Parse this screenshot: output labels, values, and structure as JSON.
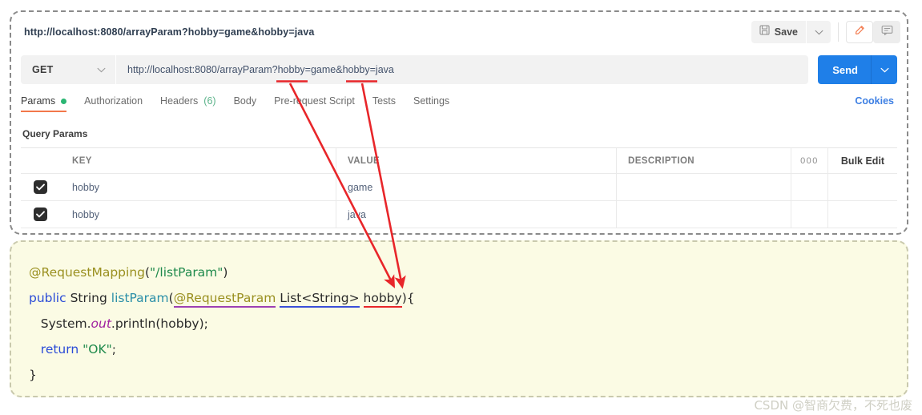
{
  "request": {
    "name": "http://localhost:8080/arrayParam?hobby=game&hobby=java",
    "save_label": "Save",
    "save_icon": "floppy-disk-icon",
    "save_caret_icon": "chevron-down-icon",
    "edit_icon": "pencil-icon",
    "comment_icon": "comment-icon",
    "method": "GET",
    "method_caret_icon": "chevron-down-icon",
    "url": "http://localhost:8080/arrayParam?hobby=game&hobby=java",
    "send_label": "Send",
    "send_caret_icon": "chevron-down-icon"
  },
  "tabs": [
    {
      "label": "Params",
      "badge": "dot",
      "active": true
    },
    {
      "label": "Authorization",
      "badge": "",
      "active": false
    },
    {
      "label": "Headers",
      "count": "(6)",
      "active": false
    },
    {
      "label": "Body",
      "badge": "",
      "active": false
    },
    {
      "label": "Pre-request Script",
      "badge": "",
      "active": false
    },
    {
      "label": "Tests",
      "badge": "",
      "active": false
    },
    {
      "label": "Settings",
      "badge": "",
      "active": false
    }
  ],
  "cookies_link": "Cookies",
  "query_params_label": "Query Params",
  "table": {
    "headers": {
      "key": "KEY",
      "value": "VALUE",
      "description": "DESCRIPTION",
      "more": "000",
      "bulk_edit": "Bulk Edit"
    },
    "rows": [
      {
        "checked": true,
        "key": "hobby",
        "value": "game",
        "description": ""
      },
      {
        "checked": true,
        "key": "hobby",
        "value": "java",
        "description": ""
      }
    ]
  },
  "code": {
    "line1": {
      "annotation": "@RequestMapping",
      "paren_open": "(",
      "string": "\"/listParam\"",
      "paren_close": ")"
    },
    "line2": {
      "kw": "public",
      "type": " String ",
      "method": "listParam",
      "paren_open": "(",
      "annotation": "@RequestParam",
      "space": " ",
      "generic": "List<String>",
      "space2": " ",
      "param": "hobby",
      "tail": "){"
    },
    "line3": {
      "pre": "   System.",
      "out": "out",
      "post": ".println(hobby);"
    },
    "line4": {
      "kw": "   return ",
      "string": "\"OK\"",
      "semi": ";"
    },
    "line5": {
      "text": "}"
    }
  },
  "annotations": {
    "arrow_color": "#e8262a",
    "underline_url_1": "hobby",
    "underline_url_2": "hobby",
    "target": "hobby"
  },
  "watermark": "CSDN @智商欠费，不死也废"
}
